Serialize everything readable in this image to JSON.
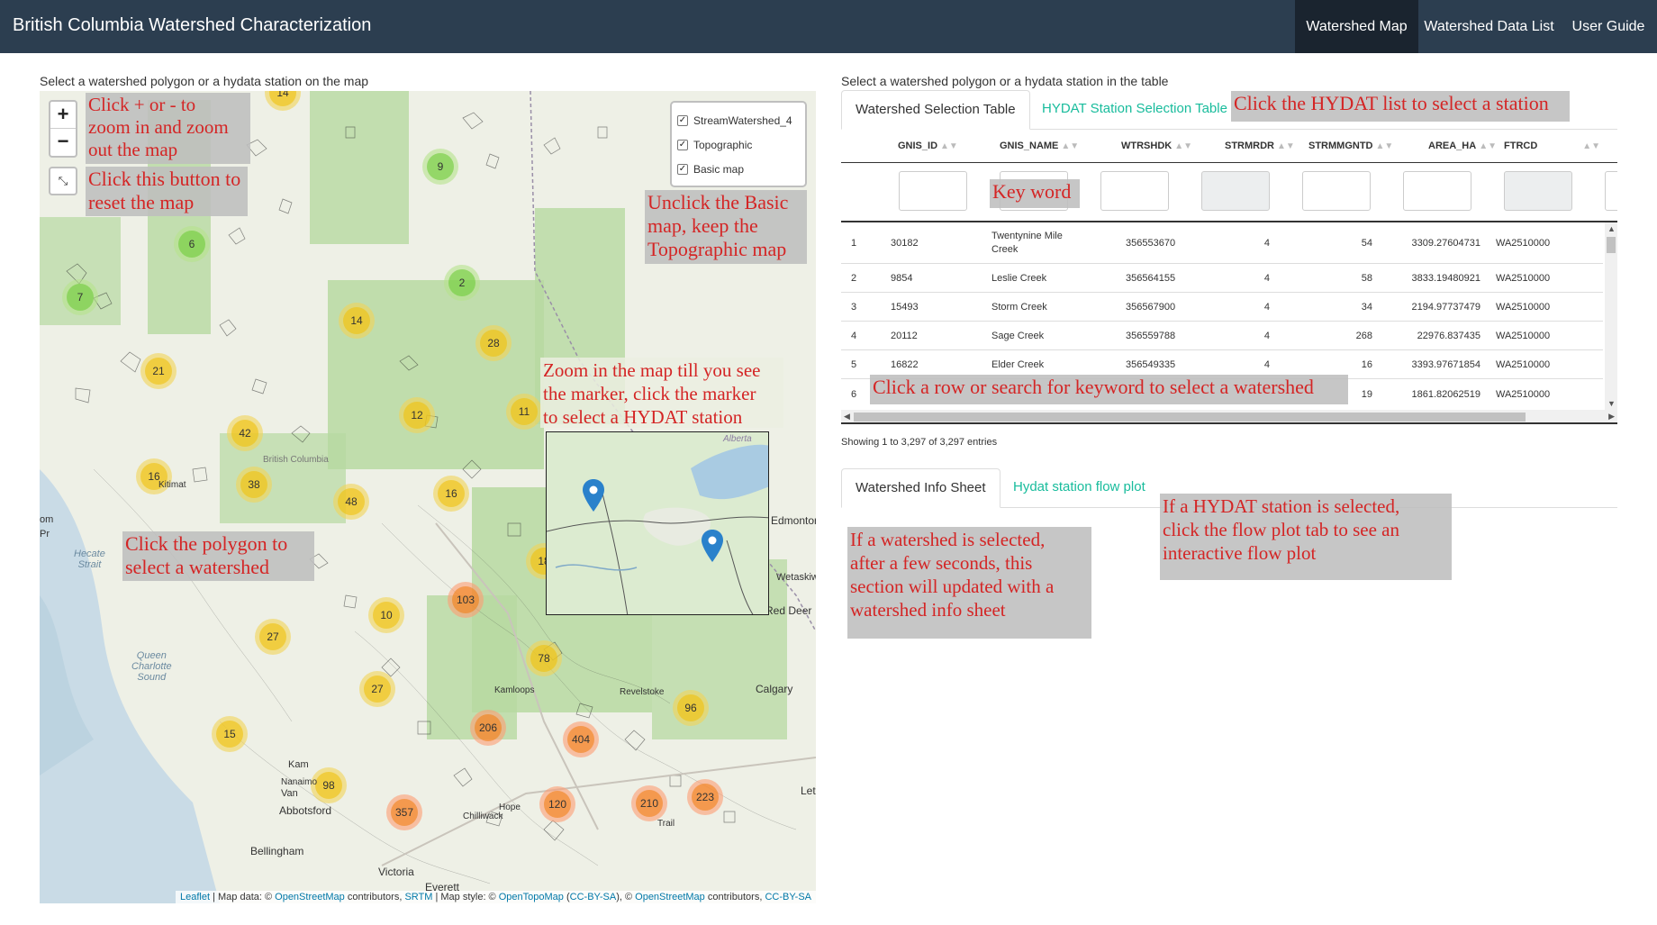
{
  "app": {
    "title": "British Columbia Watershed Characterization",
    "nav": [
      "Watershed Map",
      "Watershed Data List",
      "User Guide"
    ],
    "active_nav": "Watershed Map"
  },
  "map_panel": {
    "instruction": "Select a watershed polygon or a hydata station on the map",
    "zoom_in": "+",
    "zoom_out": "−",
    "reset_icon": "⤡",
    "layers": [
      {
        "label": "StreamWatershed_4",
        "checked": true
      },
      {
        "label": "Topographic",
        "checked": true
      },
      {
        "label": "Basic map",
        "checked": true
      }
    ],
    "clusters": [
      "14",
      "9",
      "6",
      "2",
      "7",
      "14",
      "28",
      "21",
      "12",
      "11",
      "42",
      "16",
      "38",
      "48",
      "16",
      "18",
      "103",
      "10",
      "27",
      "78",
      "27",
      "96",
      "15",
      "206",
      "404",
      "98",
      "357",
      "120",
      "210",
      "223"
    ],
    "places": {
      "alberta": "Alberta",
      "edmonton": "Edmonton",
      "wetaskiwin": "Wetaskiwin",
      "red_deer": "Red Deer",
      "calgary": "Calgary",
      "abbotsford": "Abbotsford",
      "bellingham": "Bellingham",
      "victoria": "Victoria",
      "everett": "Everett",
      "kamloops": "Kamloops",
      "revelstoke": "Revelstoke",
      "trail": "Trail",
      "hecate": "Hecate\nStrait",
      "queen_charlotte": "Queen\nCharlotte\nSound",
      "british_columbia": "British Columbia",
      "kitimat": "Kitimat",
      "leth": "Leth",
      "om": "om",
      "pr": "Pr",
      "van": "Van",
      "kam": "Kam",
      "nanaimo": "Nanaimo",
      "chilliwack": "Chilliwack",
      "hope": "Hope"
    },
    "attribution": {
      "leaflet": "Leaflet",
      "text1": " | Map data: © ",
      "osm1": "OpenStreetMap",
      "text2": " contributors, ",
      "srtm": "SRTM",
      "text3": " | Map style: © ",
      "opentopo": "OpenTopoMap",
      "text4": " (",
      "ccbysa1": "CC-BY-SA",
      "text5": "), © ",
      "osm2": "OpenStreetMap",
      "text6": " contributors, ",
      "ccbysa2": "CC-BY-SA"
    }
  },
  "annotations": {
    "zoom": "Click + or - to\nzoom in and zoom\nout the map",
    "reset": "Click this button to\nreset the map",
    "basic_map": "Unclick the Basic\nmap, keep the\nTopographic map",
    "zoom_marker": "Zoom in the map till you see\nthe marker, click the marker\nto select a HYDAT station",
    "polygon": "Click the polygon to\nselect a watershed",
    "hydat_list": "Click the HYDAT list to select a station",
    "keyword": "Key word",
    "row_search": "Click a row or search for keyword to select a watershed",
    "info_sheet": "If a watershed is selected,\nafter a few seconds, this\nsection will updated with a\nwatershed info sheet",
    "flow_plot": "If a HYDAT station is selected,\nclick the flow plot tab to see an\ninteractive flow plot"
  },
  "table_panel": {
    "instruction": "Select a watershed polygon or a hydata station in the table",
    "tabs": [
      "Watershed Selection Table",
      "HYDAT Station Selection Table"
    ],
    "active_tab": "Watershed Selection Table",
    "columns": [
      "GNIS_ID",
      "GNIS_NAME",
      "WTRSHDK",
      "STRMRDR",
      "STRMMGNTD",
      "AREA_HA",
      "FTRCD"
    ],
    "sort_icon": "▲▼",
    "rows": [
      {
        "n": "1",
        "gnis_id": "30182",
        "gnis_name": "Twentynine Mile\nCreek",
        "wtrshdk": "356553670",
        "strmrdr": "4",
        "strmmgntd": "54",
        "area_ha": "3309.27604731",
        "ftrcd": "WA2510000"
      },
      {
        "n": "2",
        "gnis_id": "9854",
        "gnis_name": "Leslie Creek",
        "wtrshdk": "356564155",
        "strmrdr": "4",
        "strmmgntd": "58",
        "area_ha": "3833.19480921",
        "ftrcd": "WA2510000"
      },
      {
        "n": "3",
        "gnis_id": "15493",
        "gnis_name": "Storm Creek",
        "wtrshdk": "356567900",
        "strmrdr": "4",
        "strmmgntd": "34",
        "area_ha": "2194.97737479",
        "ftrcd": "WA2510000"
      },
      {
        "n": "4",
        "gnis_id": "20112",
        "gnis_name": "Sage Creek",
        "wtrshdk": "356559788",
        "strmrdr": "4",
        "strmmgntd": "268",
        "area_ha": "22976.837435",
        "ftrcd": "WA2510000"
      },
      {
        "n": "5",
        "gnis_id": "16822",
        "gnis_name": "Elder Creek",
        "wtrshdk": "356549335",
        "strmrdr": "4",
        "strmmgntd": "16",
        "area_ha": "3393.97671854",
        "ftrcd": "WA2510000"
      },
      {
        "n": "6",
        "gnis_id": "",
        "gnis_name": "",
        "wtrshdk": "",
        "strmrdr": "",
        "strmmgntd": "19",
        "area_ha": "1861.82062519",
        "ftrcd": "WA2510000"
      }
    ],
    "entries_info": "Showing 1 to 3,297 of 3,297 entries",
    "bottom_tabs": [
      "Watershed Info Sheet",
      "Hydat station flow plot"
    ],
    "active_bottom_tab": "Watershed Info Sheet"
  }
}
